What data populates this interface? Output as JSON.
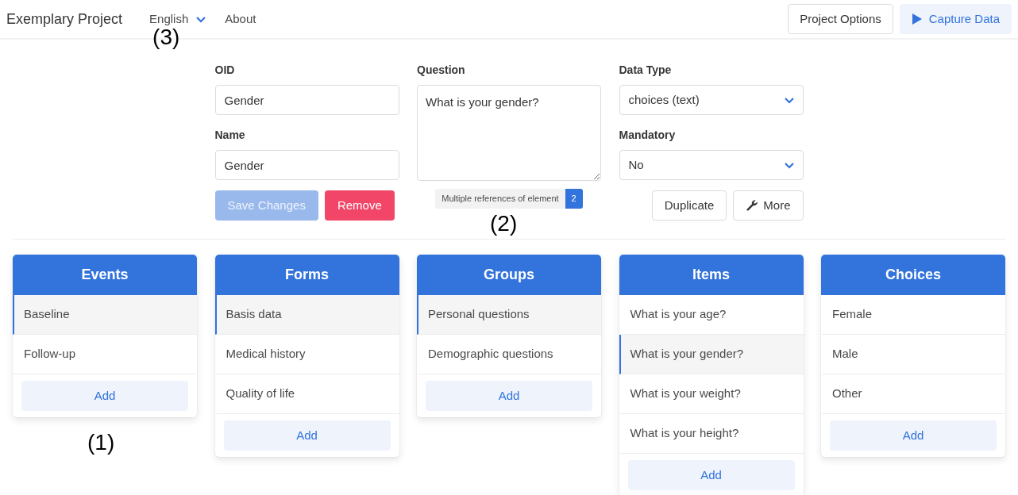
{
  "navbar": {
    "brand": "Exemplary Project",
    "language": {
      "label": "English",
      "callout": "(3)"
    },
    "links": [
      "About"
    ],
    "buttons": [
      {
        "label": "Project Options",
        "kind": "outline"
      },
      {
        "label": "Capture Data",
        "kind": "light"
      }
    ]
  },
  "form": {
    "oid": {
      "label": "OID",
      "value": "Gender"
    },
    "name": {
      "label": "Name",
      "value": "Gender"
    },
    "question": {
      "label": "Question",
      "value": "What is your gender?"
    },
    "references": {
      "text": "Multiple references of element",
      "count": "2",
      "callout": "(2)"
    },
    "data_type": {
      "label": "Data Type",
      "value": "choices (text)"
    },
    "mandatory": {
      "label": "Mandatory",
      "value": "No"
    },
    "buttons": [
      {
        "label": "Save Changes",
        "kind": "primary",
        "disabled": true
      },
      {
        "label": "Remove",
        "kind": "danger",
        "disabled": false
      }
    ],
    "tools": [
      {
        "label": "Duplicate",
        "kind": "plain"
      },
      {
        "label": "More",
        "kind": "menu"
      }
    ]
  },
  "columns": [
    {
      "title": "Events",
      "add": "Add",
      "callout": "(1)",
      "items": [
        {
          "label": "Baseline",
          "selected": true
        },
        {
          "label": "Follow-up",
          "selected": false
        }
      ]
    },
    {
      "title": "Forms",
      "add": "Add",
      "items": [
        {
          "label": "Basis data",
          "selected": true
        },
        {
          "label": "Medical history",
          "selected": false
        },
        {
          "label": "Quality of life",
          "selected": false
        }
      ]
    },
    {
      "title": "Groups",
      "add": "Add",
      "items": [
        {
          "label": "Personal questions",
          "selected": true
        },
        {
          "label": "Demographic questions",
          "selected": false
        }
      ]
    },
    {
      "title": "Items",
      "add": "Add",
      "items": [
        {
          "label": "What is your age?",
          "selected": false
        },
        {
          "label": "What is your gender?",
          "selected": true
        },
        {
          "label": "What is your weight?",
          "selected": false
        },
        {
          "label": "What is your height?",
          "selected": false
        }
      ]
    },
    {
      "title": "Choices",
      "add": "Add",
      "items": [
        {
          "label": "Female",
          "selected": false
        },
        {
          "label": "Male",
          "selected": false
        },
        {
          "label": "Other",
          "selected": false
        }
      ]
    }
  ]
}
